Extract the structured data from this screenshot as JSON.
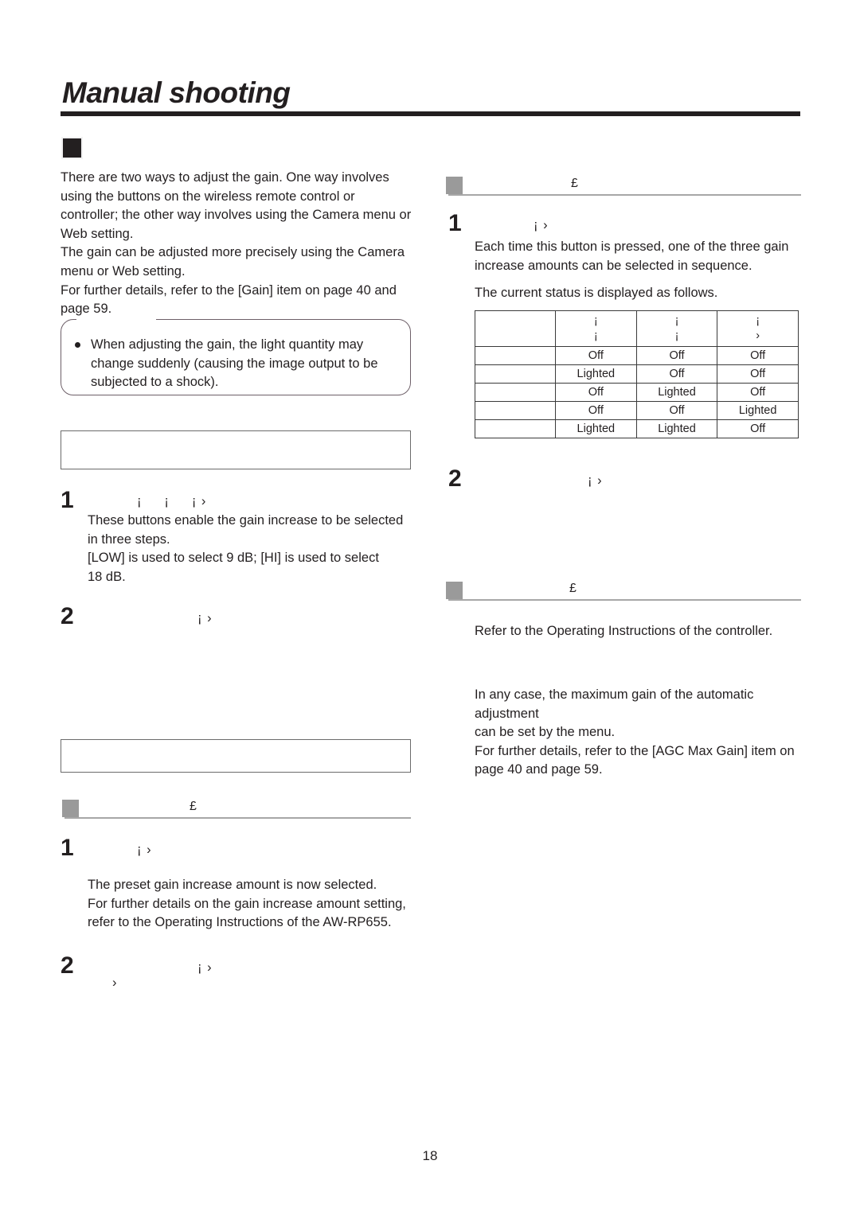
{
  "page": {
    "title": "Manual shooting",
    "number": "18"
  },
  "intro": {
    "marker": "black-square",
    "paragraph": "There are two ways to adjust the gain. One way involves\nusing the buttons on the wireless remote control or\ncontroller; the other way involves using the Camera menu or\nWeb setting.\nThe gain can be adjusted more precisely using the Camera\nmenu or Web setting.\nFor further details, refer to the [Gain] item on page 40 and\npage 59."
  },
  "note": {
    "bullet_text": "When adjusting the gain, the light quantity may\nchange suddenly (causing the image output to be\nsubjected to a shock)."
  },
  "left_column": {
    "box_1": {
      "text": ""
    },
    "section_1": {
      "steps": [
        {
          "number": "1",
          "ghost_label": "¡     ¡     ¡ ›",
          "body": "These buttons enable the gain increase to be selected\nin three steps.\n[LOW] is used to select 9 dB; [HI] is used to select\n18 dB."
        },
        {
          "number": "2",
          "ghost_label": "¡ ›",
          "body": ""
        }
      ]
    },
    "box_2": {
      "text": ""
    },
    "section_2": {
      "heading_ghost": "£",
      "steps": [
        {
          "number": "1",
          "ghost_label": "¡ ›",
          "body": "The preset gain increase amount is now selected.\nFor further details on the gain increase amount setting,\nrefer to the Operating Instructions of the AW-RP655."
        },
        {
          "number": "2",
          "ghost_label": "¡ ›",
          "ghost_label_2": "›",
          "body": ""
        }
      ]
    }
  },
  "right_column": {
    "section_1": {
      "heading_ghost": "£",
      "steps": [
        {
          "number": "1",
          "ghost_label": "¡ ›",
          "body": "Each time this button is pressed, one of the three gain\nincrease amounts can be selected in sequence."
        },
        {
          "number": "2",
          "ghost_label": "¡ ›",
          "body": ""
        }
      ],
      "table_caption": "The current status is displayed as follows."
    },
    "section_2": {
      "heading_ghost": "£",
      "body": "Refer to the Operating Instructions of the controller."
    },
    "closing": {
      "body": "In any case, the maximum gain of the automatic adjustment\ncan be set by the menu.\nFor further details, refer to the [AGC Max Gain] item on\npage 40 and page 59."
    }
  },
  "status_table": {
    "headers": [
      {
        "line1": "",
        "line2": ""
      },
      {
        "line1": "¡",
        "line2": "¡"
      },
      {
        "line1": "¡",
        "line2": "¡"
      },
      {
        "line1": "¡",
        "line2": "›"
      }
    ],
    "rows": [
      {
        "label": "",
        "cells": [
          "Off",
          "Off",
          "Off"
        ]
      },
      {
        "label": "",
        "cells": [
          "Lighted",
          "Off",
          "Off"
        ]
      },
      {
        "label": "",
        "cells": [
          "Off",
          "Lighted",
          "Off"
        ]
      },
      {
        "label": "",
        "cells": [
          "Off",
          "Off",
          "Lighted"
        ]
      },
      {
        "label": "",
        "cells": [
          "Lighted",
          "Lighted",
          "Off"
        ]
      }
    ]
  }
}
